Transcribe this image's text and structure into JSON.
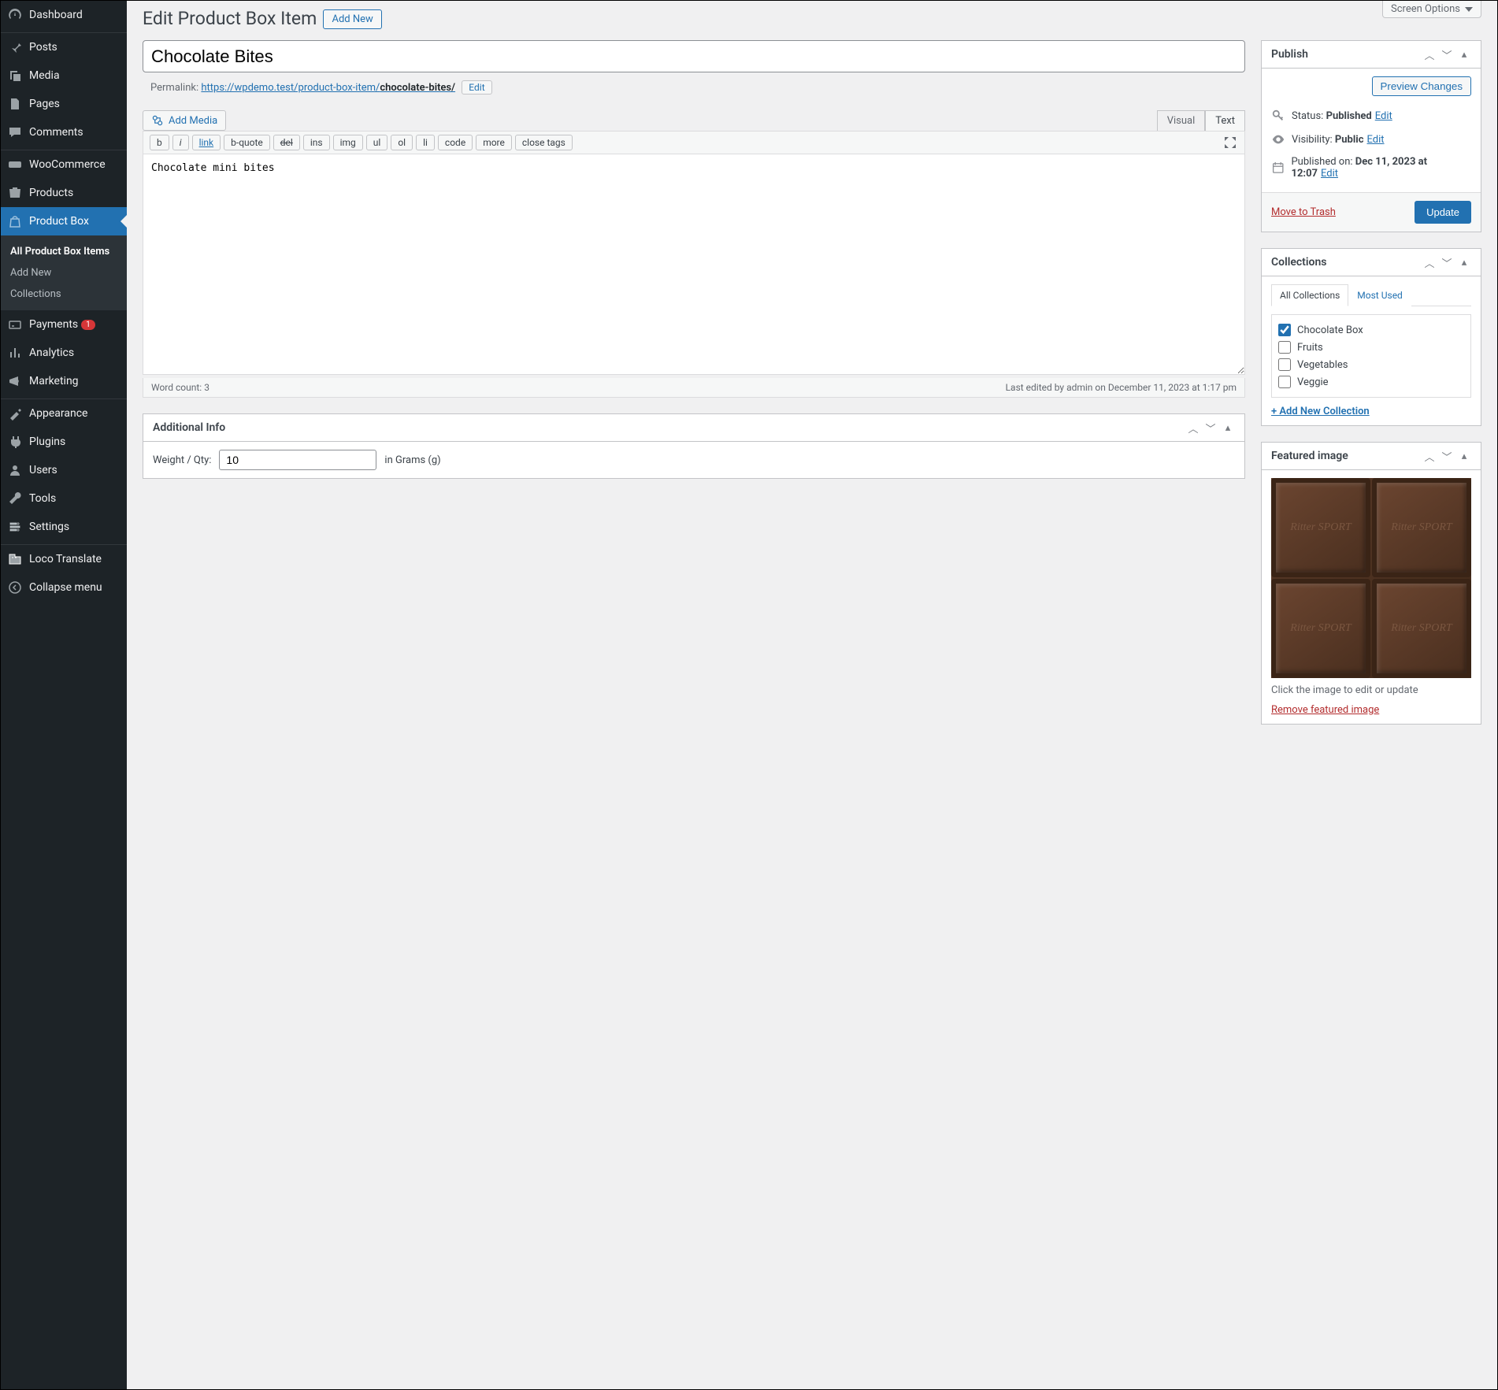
{
  "screen_options": "Screen Options",
  "page": {
    "title": "Edit Product Box Item",
    "add_new": "Add New"
  },
  "sidebar": {
    "items": [
      {
        "label": "Dashboard",
        "icon": "dashboard"
      },
      {
        "label": "Posts",
        "icon": "pin"
      },
      {
        "label": "Media",
        "icon": "media"
      },
      {
        "label": "Pages",
        "icon": "pages"
      },
      {
        "label": "Comments",
        "icon": "comments"
      },
      {
        "label": "WooCommerce",
        "icon": "woo"
      },
      {
        "label": "Products",
        "icon": "products"
      },
      {
        "label": "Product Box",
        "icon": "bag",
        "current": true
      },
      {
        "label": "Payments",
        "icon": "payments",
        "badge": "1"
      },
      {
        "label": "Analytics",
        "icon": "analytics"
      },
      {
        "label": "Marketing",
        "icon": "marketing"
      },
      {
        "label": "Appearance",
        "icon": "appearance"
      },
      {
        "label": "Plugins",
        "icon": "plugins"
      },
      {
        "label": "Users",
        "icon": "users"
      },
      {
        "label": "Tools",
        "icon": "tools"
      },
      {
        "label": "Settings",
        "icon": "settings"
      },
      {
        "label": "Loco Translate",
        "icon": "loco"
      },
      {
        "label": "Collapse menu",
        "icon": "collapse"
      }
    ],
    "submenu": [
      {
        "label": "All Product Box Items",
        "current": true
      },
      {
        "label": "Add New"
      },
      {
        "label": "Collections"
      }
    ]
  },
  "post": {
    "title": "Chocolate Bites",
    "permalink_label": "Permalink:",
    "permalink_base": "https://wpdemo.test/product-box-item/",
    "permalink_slug": "chocolate-bites/",
    "edit_slug": "Edit",
    "content": "Chocolate mini bites"
  },
  "editor": {
    "add_media": "Add Media",
    "tabs": {
      "visual": "Visual",
      "text": "Text"
    },
    "buttons": [
      "b",
      "i",
      "link",
      "b-quote",
      "del",
      "ins",
      "img",
      "ul",
      "ol",
      "li",
      "code",
      "more",
      "close tags"
    ],
    "word_count_label": "Word count:",
    "word_count": "3",
    "last_edited": "Last edited by admin on December 11, 2023 at 1:17 pm"
  },
  "additional_info": {
    "title": "Additional Info",
    "weight_label": "Weight / Qty:",
    "weight_value": "10",
    "weight_unit": "in Grams (g)"
  },
  "publish": {
    "title": "Publish",
    "preview": "Preview Changes",
    "status_label": "Status:",
    "status_value": "Published",
    "status_edit": "Edit",
    "visibility_label": "Visibility:",
    "visibility_value": "Public",
    "visibility_edit": "Edit",
    "date_label": "Published on:",
    "date_value": "Dec 11, 2023 at 12:07",
    "date_edit": "Edit",
    "trash": "Move to Trash",
    "update": "Update"
  },
  "collections": {
    "title": "Collections",
    "tab_all": "All Collections",
    "tab_used": "Most Used",
    "items": [
      {
        "label": "Chocolate Box",
        "checked": true
      },
      {
        "label": "Fruits",
        "checked": false
      },
      {
        "label": "Vegetables",
        "checked": false
      },
      {
        "label": "Veggie",
        "checked": false
      }
    ],
    "add_new": "+ Add New Collection"
  },
  "featured": {
    "title": "Featured image",
    "brand": "Ritter SPORT",
    "help": "Click the image to edit or update",
    "remove": "Remove featured image"
  }
}
